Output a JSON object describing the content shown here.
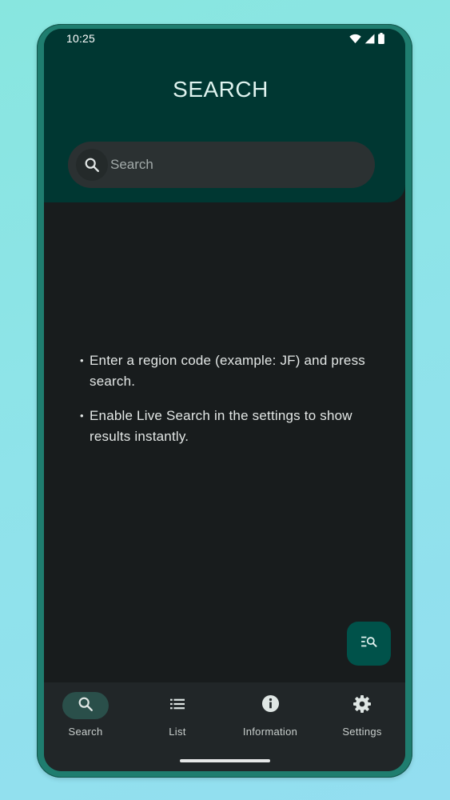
{
  "status_bar": {
    "time": "10:25"
  },
  "header": {
    "title": "SEARCH"
  },
  "search": {
    "placeholder": "Search",
    "value": ""
  },
  "tips": [
    "Enter a region code (example: JF) and press search.",
    "Enable Live Search in the settings to show results instantly."
  ],
  "fab": {
    "icon": "search-list-icon"
  },
  "bottom_nav": {
    "items": [
      {
        "label": "Search",
        "icon": "search-icon",
        "active": true
      },
      {
        "label": "List",
        "icon": "list-icon",
        "active": false
      },
      {
        "label": "Information",
        "icon": "info-icon",
        "active": false
      },
      {
        "label": "Settings",
        "icon": "gear-icon",
        "active": false
      }
    ]
  },
  "colors": {
    "header_bg": "#003732",
    "screen_bg": "#181c1d",
    "nav_bg": "#212628",
    "accent": "#00524a",
    "active_pill": "#2a4f4a"
  }
}
